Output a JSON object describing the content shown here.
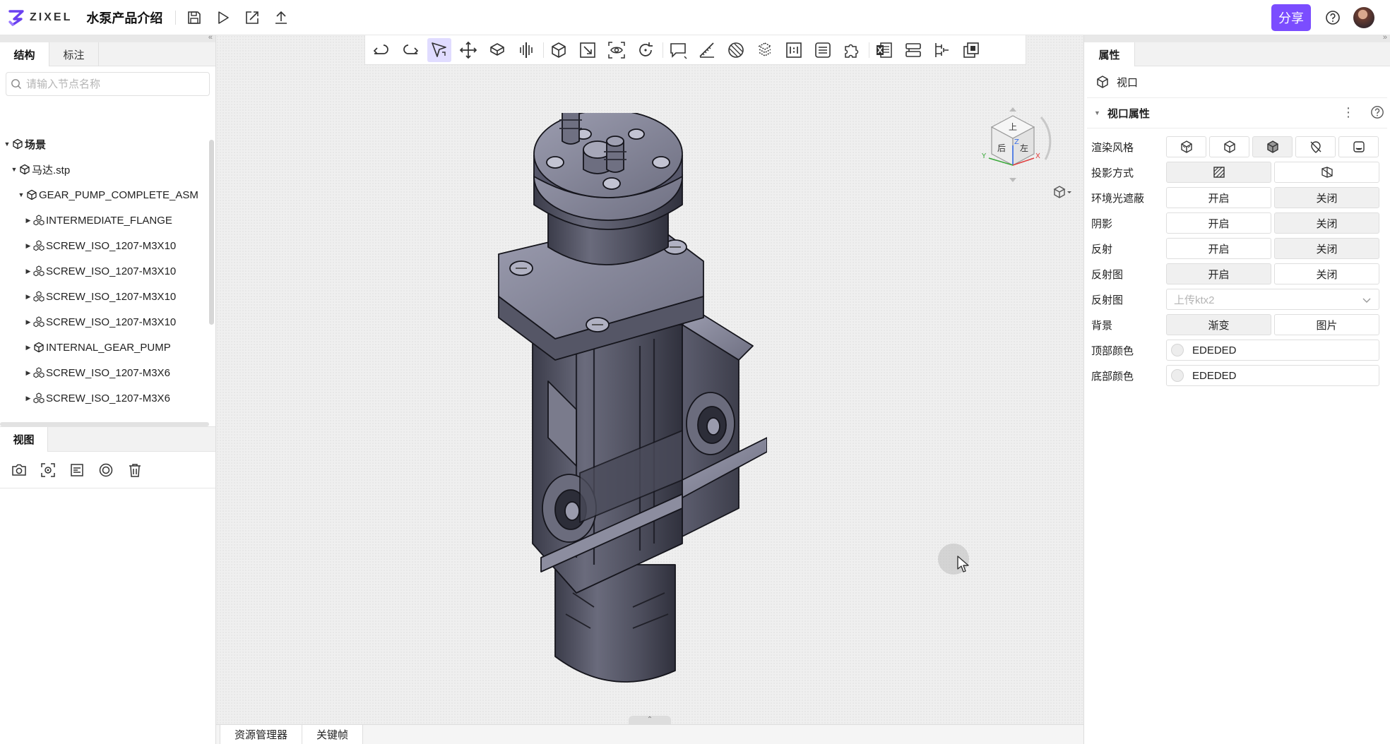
{
  "header": {
    "logo_text": "ZIXEL",
    "project_title": "水泵产品介绍",
    "share_label": "分享",
    "accent_color": "#7b4dff"
  },
  "left_panel": {
    "tabs": [
      {
        "label": "结构",
        "active": true
      },
      {
        "label": "标注",
        "active": false
      }
    ],
    "search": {
      "placeholder": "请输入节点名称",
      "value": ""
    },
    "tree": [
      {
        "label": "场景",
        "level": 0,
        "icon": "scene-icon",
        "expanded": true,
        "bold": true
      },
      {
        "label": "马达.stp",
        "level": 1,
        "icon": "part-icon",
        "expanded": true,
        "bold": false
      },
      {
        "label": "GEAR_PUMP_COMPLETE_ASM",
        "level": 2,
        "icon": "part-icon",
        "expanded": true,
        "bold": false
      },
      {
        "label": "INTERMEDIATE_FLANGE",
        "level": 3,
        "icon": "assembly-icon",
        "expanded": false,
        "bold": false
      },
      {
        "label": "SCREW_ISO_1207-M3X10",
        "level": 3,
        "icon": "assembly-icon",
        "expanded": false,
        "bold": false
      },
      {
        "label": "SCREW_ISO_1207-M3X10",
        "level": 3,
        "icon": "assembly-icon",
        "expanded": false,
        "bold": false
      },
      {
        "label": "SCREW_ISO_1207-M3X10",
        "level": 3,
        "icon": "assembly-icon",
        "expanded": false,
        "bold": false
      },
      {
        "label": "SCREW_ISO_1207-M3X10",
        "level": 3,
        "icon": "assembly-icon",
        "expanded": false,
        "bold": false
      },
      {
        "label": "INTERNAL_GEAR_PUMP",
        "level": 3,
        "icon": "part-icon",
        "expanded": false,
        "bold": false
      },
      {
        "label": "SCREW_ISO_1207-M3X6",
        "level": 3,
        "icon": "assembly-icon",
        "expanded": false,
        "bold": false
      },
      {
        "label": "SCREW_ISO_1207-M3X6",
        "level": 3,
        "icon": "assembly-icon",
        "expanded": false,
        "bold": false
      }
    ],
    "view_tab": "视图",
    "view_tools": [
      "camera-icon",
      "focus-icon",
      "list-icon",
      "ring-icon",
      "trash-icon"
    ]
  },
  "toolbar": {
    "tools": [
      "undo-icon",
      "redo-icon",
      "select-icon",
      "move-icon",
      "explode-icon",
      "section-icon",
      "box-icon",
      "fit-icon",
      "view-eye-icon",
      "rotate-icon",
      "comment-icon",
      "measure-icon",
      "material-icon",
      "structure-icon",
      "ratio-icon",
      "list-icon",
      "puzzle-icon",
      "excel-icon",
      "layout-icon",
      "bom-icon",
      "multi-window-icon"
    ],
    "active_tool": "select-icon"
  },
  "view_cube": {
    "faces": {
      "top": "上",
      "back": "后",
      "left": "左"
    },
    "axes": {
      "x": "X",
      "y": "Y",
      "z": "Z"
    }
  },
  "bottom_tabs": [
    "资源管理器",
    "关键帧"
  ],
  "right_panel": {
    "tab": "属性",
    "object_label": "视口",
    "section_title": "视口属性",
    "props": {
      "render_style": {
        "label": "渲染风格"
      },
      "projection": {
        "label": "投影方式"
      },
      "ambient_occlusion": {
        "label": "环境光遮蔽",
        "options": [
          "开启",
          "关闭"
        ],
        "selected": "关闭"
      },
      "shadow": {
        "label": "阴影",
        "options": [
          "开启",
          "关闭"
        ],
        "selected": "关闭"
      },
      "reflection": {
        "label": "反射",
        "options": [
          "开启",
          "关闭"
        ],
        "selected": "关闭"
      },
      "reflection_map_toggle": {
        "label": "反射图",
        "options": [
          "开启",
          "关闭"
        ],
        "selected": "开启"
      },
      "reflection_map_upload": {
        "label": "反射图",
        "placeholder": "上传ktx2"
      },
      "background": {
        "label": "背景",
        "options": [
          "渐变",
          "图片"
        ],
        "selected": "渐变"
      },
      "top_color": {
        "label": "顶部颜色",
        "value": "EDEDED",
        "swatch": "#EDEDED"
      },
      "bottom_color": {
        "label": "底部颜色",
        "value": "EDEDED",
        "swatch": "#EDEDED"
      }
    }
  }
}
